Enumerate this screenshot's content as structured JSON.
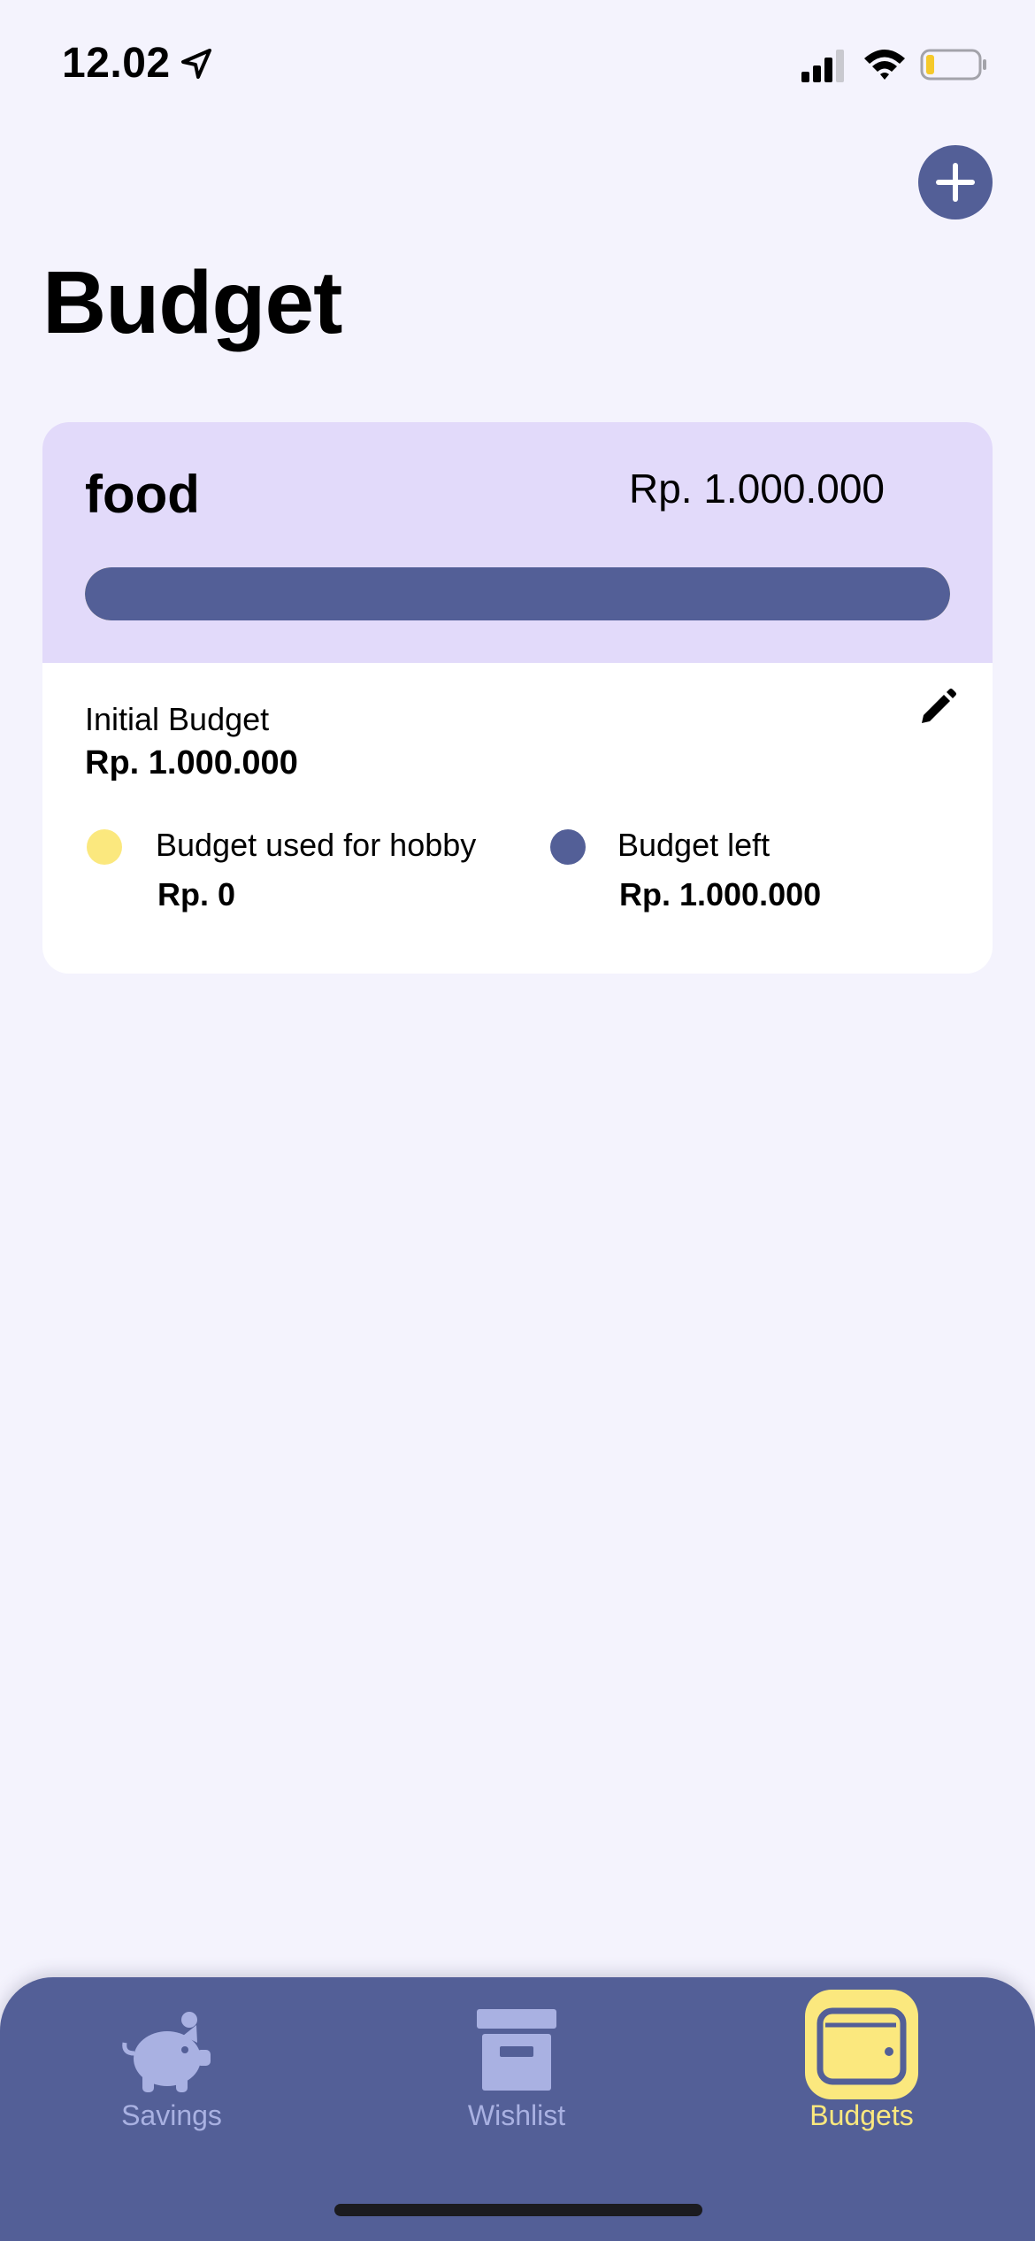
{
  "status_bar": {
    "time": "12.02",
    "icons": [
      "location-arrow-icon",
      "cellular-signal-icon",
      "wifi-icon",
      "battery-icon"
    ]
  },
  "header": {
    "title": "Budget",
    "add_icon": "plus-icon"
  },
  "budget_card": {
    "category": "food",
    "amount": "Rp. 1.000.000",
    "progress_left_fraction": 1.0,
    "initial_budget_label": "Initial Budget",
    "initial_budget_value": "Rp. 1.000.000",
    "edit_icon": "pencil-icon",
    "legend": {
      "used_label": "Budget used for hobby",
      "used_value": "Rp. 0",
      "left_label": "Budget left",
      "left_value": "Rp. 1.000.000"
    }
  },
  "tab_bar": {
    "tabs": [
      {
        "label": "Savings",
        "icon": "piggy-bank-icon",
        "active": false
      },
      {
        "label": "Wishlist",
        "icon": "archive-box-icon",
        "active": false
      },
      {
        "label": "Budgets",
        "icon": "wallet-icon",
        "active": true
      }
    ]
  },
  "colors": {
    "background": "#f4f3fd",
    "primary": "#535f97",
    "card_header": "#e2dafa",
    "accent_yellow": "#fbe87e",
    "inactive_tab": "#a9b1e2"
  }
}
